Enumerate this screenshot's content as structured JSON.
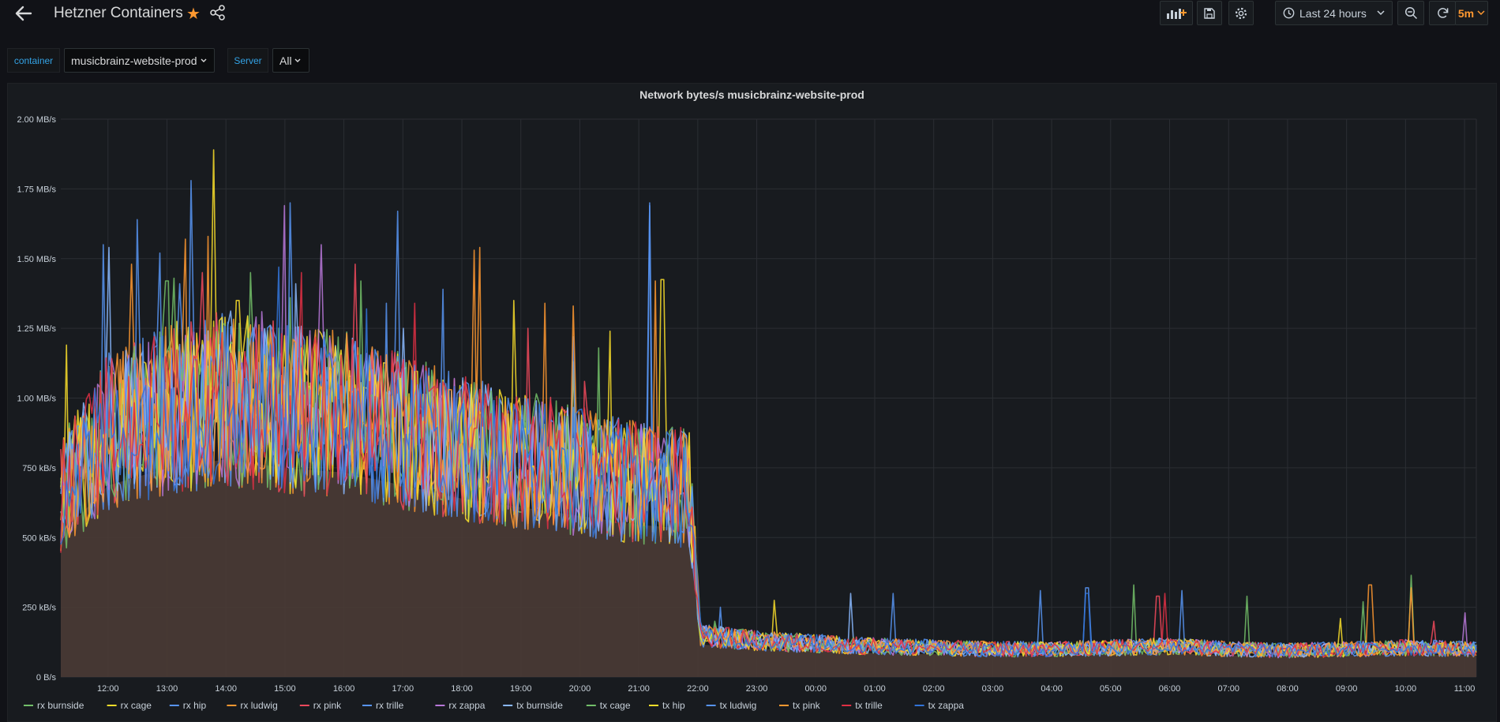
{
  "header": {
    "title": "Hetzner Containers",
    "time_range": "Last 24 hours",
    "refresh_interval": "5m",
    "icons": [
      "arrow-left-icon",
      "star-icon",
      "share-icon",
      "add-panel-icon",
      "save-icon",
      "settings-icon",
      "clock-icon",
      "zoom-out-icon",
      "refresh-icon"
    ]
  },
  "variables": [
    {
      "label": "container",
      "value": "musicbrainz-website-prod"
    },
    {
      "label": "Server",
      "value": "All"
    }
  ],
  "colors": {
    "accent": "#ff9830",
    "link": "#33a2e5",
    "area_fill": "#4a3b35"
  },
  "chart_data": {
    "type": "line",
    "title": "Network bytes/s musicbrainz-website-prod",
    "y_ticks": [
      "0 B/s",
      "250 kB/s",
      "500 kB/s",
      "750 kB/s",
      "1.00 MB/s",
      "1.25 MB/s",
      "1.50 MB/s",
      "1.75 MB/s",
      "2.00 MB/s"
    ],
    "ylim_kBps": [
      0,
      2000
    ],
    "x_ticks": [
      "12:00",
      "13:00",
      "14:00",
      "15:00",
      "16:00",
      "17:00",
      "18:00",
      "19:00",
      "20:00",
      "21:00",
      "22:00",
      "23:00",
      "00:00",
      "01:00",
      "02:00",
      "03:00",
      "04:00",
      "05:00",
      "06:00",
      "07:00",
      "08:00",
      "09:00",
      "10:00",
      "11:00"
    ],
    "x_range_hours": [
      11.2,
      35.2
    ],
    "grid": true,
    "legend_position": "bottom",
    "level_profile_kBps": {
      "hours": [
        11.2,
        12.0,
        13.0,
        14.0,
        15.0,
        16.0,
        17.0,
        18.0,
        19.0,
        20.0,
        21.0,
        21.85,
        22.05,
        22.5,
        23.0,
        24.0,
        25.0,
        26.0,
        27.0,
        28.0,
        29.0,
        30.0,
        31.0,
        32.0,
        33.0,
        34.0,
        35.2
      ],
      "values": [
        650,
        880,
        960,
        1000,
        960,
        940,
        880,
        820,
        780,
        740,
        700,
        680,
        150,
        140,
        130,
        120,
        110,
        105,
        100,
        100,
        105,
        110,
        100,
        95,
        100,
        105,
        100
      ]
    },
    "series": [
      {
        "name": "rx burnside",
        "color": "#73bf69",
        "peaks": [
          [
            13.0,
            1420
          ],
          [
            14.4,
            1450
          ],
          [
            15.1,
            1360
          ],
          [
            22.3,
            200
          ],
          [
            29.4,
            330
          ],
          [
            33.3,
            270
          ],
          [
            34.1,
            365
          ]
        ]
      },
      {
        "name": "rx cage",
        "color": "#fade2a",
        "peaks": [
          [
            11.3,
            1190
          ],
          [
            13.8,
            1890
          ],
          [
            14.0,
            1290
          ],
          [
            19.9,
            1130
          ],
          [
            21.4,
            1425
          ],
          [
            23.3,
            275
          ]
        ]
      },
      {
        "name": "rx hip",
        "color": "#5794f2",
        "peaks": [
          [
            13.2,
            1410
          ],
          [
            16.9,
            1670
          ],
          [
            21.2,
            1700
          ],
          [
            22.4,
            250
          ],
          [
            25.3,
            300
          ],
          [
            28.6,
            320
          ]
        ]
      },
      {
        "name": "rx ludwig",
        "color": "#ff9830",
        "peaks": [
          [
            12.4,
            1480
          ],
          [
            13.3,
            1570
          ],
          [
            18.2,
            1530
          ],
          [
            19.4,
            1340
          ],
          [
            21.3,
            1420
          ],
          [
            33.4,
            330
          ]
        ]
      },
      {
        "name": "rx pink",
        "color": "#f2495c",
        "peaks": [
          [
            13.6,
            1450
          ],
          [
            16.2,
            1480
          ],
          [
            19.1,
            1250
          ],
          [
            20.1,
            1060
          ],
          [
            29.8,
            290
          ],
          [
            34.5,
            200
          ]
        ]
      },
      {
        "name": "rx trille",
        "color": "#5794f2",
        "peaks": [
          [
            11.9,
            1550
          ],
          [
            12.5,
            1640
          ],
          [
            13.4,
            1780
          ],
          [
            15.1,
            1700
          ],
          [
            17.7,
            1390
          ],
          [
            21.2,
            1690
          ],
          [
            27.8,
            310
          ]
        ]
      },
      {
        "name": "rx zappa",
        "color": "#b877d9",
        "peaks": [
          [
            15.0,
            1690
          ],
          [
            15.6,
            1550
          ],
          [
            14.6,
            1310
          ],
          [
            35.0,
            230
          ]
        ]
      },
      {
        "name": "tx burnside",
        "color": "#8ab8ff",
        "peaks": [
          [
            12.0,
            1540
          ],
          [
            15.2,
            1410
          ],
          [
            17.0,
            1250
          ],
          [
            24.6,
            300
          ]
        ]
      },
      {
        "name": "tx cage",
        "color": "#73bf69",
        "peaks": [
          [
            13.1,
            1430
          ],
          [
            16.3,
            1420
          ],
          [
            20.3,
            1180
          ],
          [
            31.3,
            290
          ]
        ]
      },
      {
        "name": "tx hip",
        "color": "#fade2a",
        "peaks": [
          [
            14.2,
            1350
          ],
          [
            18.9,
            1350
          ],
          [
            20.5,
            1240
          ],
          [
            32.9,
            210
          ]
        ]
      },
      {
        "name": "tx ludwig",
        "color": "#5794f2",
        "peaks": [
          [
            12.9,
            1520
          ],
          [
            16.7,
            1340
          ],
          [
            19.9,
            1220
          ],
          [
            30.2,
            310
          ]
        ]
      },
      {
        "name": "tx pink",
        "color": "#ff9830",
        "peaks": [
          [
            13.7,
            1580
          ],
          [
            18.3,
            1540
          ],
          [
            19.9,
            1330
          ],
          [
            34.1,
            320
          ]
        ]
      },
      {
        "name": "tx trille",
        "color": "#e02f44",
        "peaks": [
          [
            15.3,
            1450
          ],
          [
            17.2,
            1340
          ],
          [
            29.9,
            300
          ]
        ]
      },
      {
        "name": "tx zappa",
        "color": "#3274d9",
        "peaks": [
          [
            14.9,
            1470
          ],
          [
            16.4,
            1320
          ],
          [
            28.6,
            300
          ]
        ]
      }
    ]
  }
}
